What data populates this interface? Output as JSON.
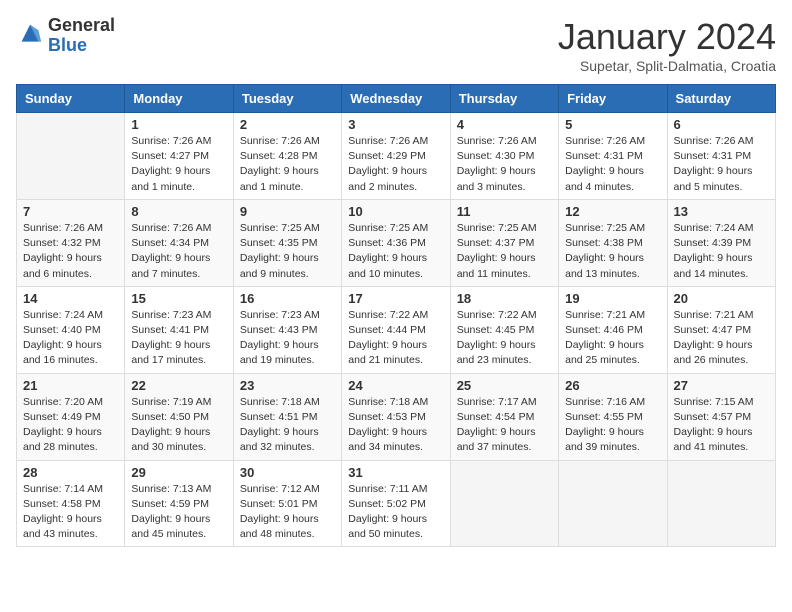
{
  "logo": {
    "general": "General",
    "blue": "Blue"
  },
  "header": {
    "month": "January 2024",
    "location": "Supetar, Split-Dalmatia, Croatia"
  },
  "weekdays": [
    "Sunday",
    "Monday",
    "Tuesday",
    "Wednesday",
    "Thursday",
    "Friday",
    "Saturday"
  ],
  "weeks": [
    [
      {
        "day": "",
        "sunrise": "",
        "sunset": "",
        "daylight": ""
      },
      {
        "day": "1",
        "sunrise": "Sunrise: 7:26 AM",
        "sunset": "Sunset: 4:27 PM",
        "daylight": "Daylight: 9 hours and 1 minute."
      },
      {
        "day": "2",
        "sunrise": "Sunrise: 7:26 AM",
        "sunset": "Sunset: 4:28 PM",
        "daylight": "Daylight: 9 hours and 1 minute."
      },
      {
        "day": "3",
        "sunrise": "Sunrise: 7:26 AM",
        "sunset": "Sunset: 4:29 PM",
        "daylight": "Daylight: 9 hours and 2 minutes."
      },
      {
        "day": "4",
        "sunrise": "Sunrise: 7:26 AM",
        "sunset": "Sunset: 4:30 PM",
        "daylight": "Daylight: 9 hours and 3 minutes."
      },
      {
        "day": "5",
        "sunrise": "Sunrise: 7:26 AM",
        "sunset": "Sunset: 4:31 PM",
        "daylight": "Daylight: 9 hours and 4 minutes."
      },
      {
        "day": "6",
        "sunrise": "Sunrise: 7:26 AM",
        "sunset": "Sunset: 4:31 PM",
        "daylight": "Daylight: 9 hours and 5 minutes."
      }
    ],
    [
      {
        "day": "7",
        "sunrise": "Sunrise: 7:26 AM",
        "sunset": "Sunset: 4:32 PM",
        "daylight": "Daylight: 9 hours and 6 minutes."
      },
      {
        "day": "8",
        "sunrise": "Sunrise: 7:26 AM",
        "sunset": "Sunset: 4:34 PM",
        "daylight": "Daylight: 9 hours and 7 minutes."
      },
      {
        "day": "9",
        "sunrise": "Sunrise: 7:25 AM",
        "sunset": "Sunset: 4:35 PM",
        "daylight": "Daylight: 9 hours and 9 minutes."
      },
      {
        "day": "10",
        "sunrise": "Sunrise: 7:25 AM",
        "sunset": "Sunset: 4:36 PM",
        "daylight": "Daylight: 9 hours and 10 minutes."
      },
      {
        "day": "11",
        "sunrise": "Sunrise: 7:25 AM",
        "sunset": "Sunset: 4:37 PM",
        "daylight": "Daylight: 9 hours and 11 minutes."
      },
      {
        "day": "12",
        "sunrise": "Sunrise: 7:25 AM",
        "sunset": "Sunset: 4:38 PM",
        "daylight": "Daylight: 9 hours and 13 minutes."
      },
      {
        "day": "13",
        "sunrise": "Sunrise: 7:24 AM",
        "sunset": "Sunset: 4:39 PM",
        "daylight": "Daylight: 9 hours and 14 minutes."
      }
    ],
    [
      {
        "day": "14",
        "sunrise": "Sunrise: 7:24 AM",
        "sunset": "Sunset: 4:40 PM",
        "daylight": "Daylight: 9 hours and 16 minutes."
      },
      {
        "day": "15",
        "sunrise": "Sunrise: 7:23 AM",
        "sunset": "Sunset: 4:41 PM",
        "daylight": "Daylight: 9 hours and 17 minutes."
      },
      {
        "day": "16",
        "sunrise": "Sunrise: 7:23 AM",
        "sunset": "Sunset: 4:43 PM",
        "daylight": "Daylight: 9 hours and 19 minutes."
      },
      {
        "day": "17",
        "sunrise": "Sunrise: 7:22 AM",
        "sunset": "Sunset: 4:44 PM",
        "daylight": "Daylight: 9 hours and 21 minutes."
      },
      {
        "day": "18",
        "sunrise": "Sunrise: 7:22 AM",
        "sunset": "Sunset: 4:45 PM",
        "daylight": "Daylight: 9 hours and 23 minutes."
      },
      {
        "day": "19",
        "sunrise": "Sunrise: 7:21 AM",
        "sunset": "Sunset: 4:46 PM",
        "daylight": "Daylight: 9 hours and 25 minutes."
      },
      {
        "day": "20",
        "sunrise": "Sunrise: 7:21 AM",
        "sunset": "Sunset: 4:47 PM",
        "daylight": "Daylight: 9 hours and 26 minutes."
      }
    ],
    [
      {
        "day": "21",
        "sunrise": "Sunrise: 7:20 AM",
        "sunset": "Sunset: 4:49 PM",
        "daylight": "Daylight: 9 hours and 28 minutes."
      },
      {
        "day": "22",
        "sunrise": "Sunrise: 7:19 AM",
        "sunset": "Sunset: 4:50 PM",
        "daylight": "Daylight: 9 hours and 30 minutes."
      },
      {
        "day": "23",
        "sunrise": "Sunrise: 7:18 AM",
        "sunset": "Sunset: 4:51 PM",
        "daylight": "Daylight: 9 hours and 32 minutes."
      },
      {
        "day": "24",
        "sunrise": "Sunrise: 7:18 AM",
        "sunset": "Sunset: 4:53 PM",
        "daylight": "Daylight: 9 hours and 34 minutes."
      },
      {
        "day": "25",
        "sunrise": "Sunrise: 7:17 AM",
        "sunset": "Sunset: 4:54 PM",
        "daylight": "Daylight: 9 hours and 37 minutes."
      },
      {
        "day": "26",
        "sunrise": "Sunrise: 7:16 AM",
        "sunset": "Sunset: 4:55 PM",
        "daylight": "Daylight: 9 hours and 39 minutes."
      },
      {
        "day": "27",
        "sunrise": "Sunrise: 7:15 AM",
        "sunset": "Sunset: 4:57 PM",
        "daylight": "Daylight: 9 hours and 41 minutes."
      }
    ],
    [
      {
        "day": "28",
        "sunrise": "Sunrise: 7:14 AM",
        "sunset": "Sunset: 4:58 PM",
        "daylight": "Daylight: 9 hours and 43 minutes."
      },
      {
        "day": "29",
        "sunrise": "Sunrise: 7:13 AM",
        "sunset": "Sunset: 4:59 PM",
        "daylight": "Daylight: 9 hours and 45 minutes."
      },
      {
        "day": "30",
        "sunrise": "Sunrise: 7:12 AM",
        "sunset": "Sunset: 5:01 PM",
        "daylight": "Daylight: 9 hours and 48 minutes."
      },
      {
        "day": "31",
        "sunrise": "Sunrise: 7:11 AM",
        "sunset": "Sunset: 5:02 PM",
        "daylight": "Daylight: 9 hours and 50 minutes."
      },
      {
        "day": "",
        "sunrise": "",
        "sunset": "",
        "daylight": ""
      },
      {
        "day": "",
        "sunrise": "",
        "sunset": "",
        "daylight": ""
      },
      {
        "day": "",
        "sunrise": "",
        "sunset": "",
        "daylight": ""
      }
    ]
  ]
}
